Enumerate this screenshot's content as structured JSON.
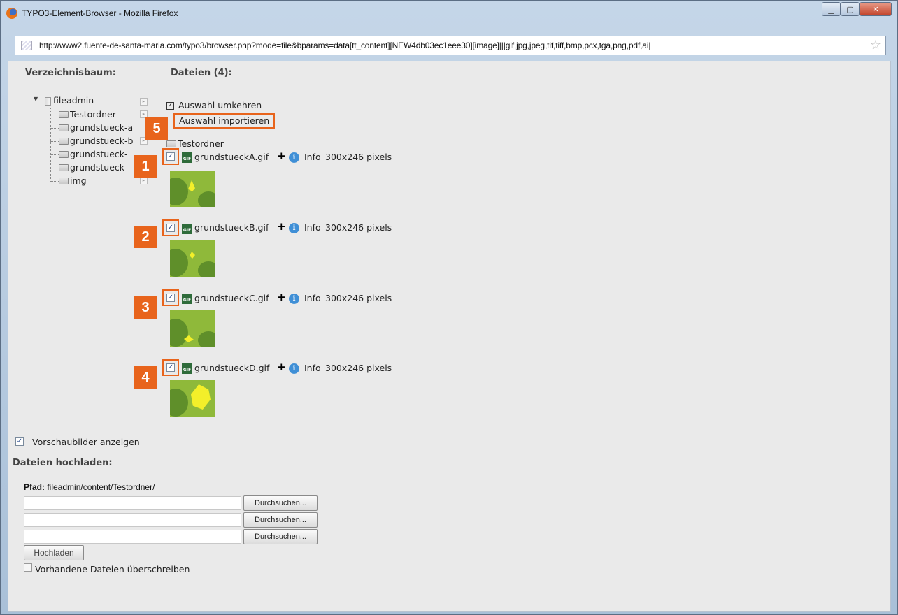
{
  "window": {
    "title": "TYPO3-Element-Browser - Mozilla Firefox",
    "url": "http://www2.fuente-de-santa-maria.com/typo3/browser.php?mode=file&bparams=data[tt_content][NEW4db03ec1eee30][image]|||gif,jpg,jpeg,tif,tiff,bmp,pcx,tga,png,pdf,ai|"
  },
  "tree": {
    "heading": "Verzeichnisbaum:",
    "root": "fileadmin",
    "folders": [
      "Testordner",
      "grundstueck-a",
      "grundstueck-b",
      "grundstueck-",
      "grundstueck-",
      "img"
    ]
  },
  "files": {
    "heading": "Dateien (4):",
    "invert_selection": "Auswahl umkehren",
    "import_selection": "Auswahl importieren",
    "subfolder": "Testordner",
    "icon_type": "GIF",
    "plus_label": "+",
    "info_label": "Info",
    "items": [
      {
        "name": "grundstueckA.gif",
        "dims": "300x246 pixels",
        "badge": "1",
        "checked": true
      },
      {
        "name": "grundstueckB.gif",
        "dims": "300x246 pixels",
        "badge": "2",
        "checked": true
      },
      {
        "name": "grundstueckC.gif",
        "dims": "300x246 pixels",
        "badge": "3",
        "checked": true
      },
      {
        "name": "grundstueckD.gif",
        "dims": "300x246 pixels",
        "badge": "4",
        "checked": true
      }
    ],
    "import_badge": "5"
  },
  "preview": {
    "label": "Vorschaubilder anzeigen",
    "checked": true
  },
  "upload": {
    "heading": "Dateien hochladen:",
    "path_label": "Pfad:",
    "path_value": "fileadmin/content/Testordner/",
    "browse_label": "Durchsuchen...",
    "upload_button": "Hochladen",
    "overwrite_label": "Vorhandene Dateien überschreiben",
    "overwrite_checked": false
  },
  "colors": {
    "accent": "#e8641c",
    "info": "#3f8fd6",
    "thumb_green": "#8fb93a",
    "thumb_yellow": "#f3ef2a"
  }
}
